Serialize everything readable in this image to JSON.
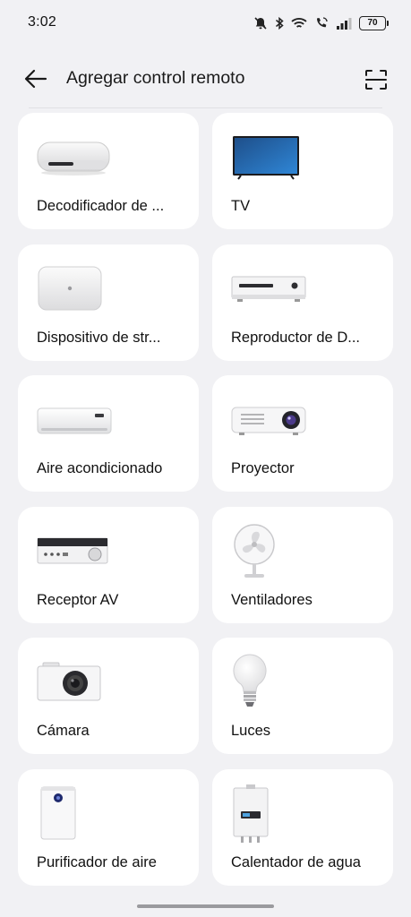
{
  "status_bar": {
    "time": "3:02",
    "battery": "70",
    "icons": [
      "mute-bell-icon",
      "bluetooth-icon",
      "wifi-icon",
      "wifi-calling-icon",
      "signal-icon",
      "battery-icon"
    ]
  },
  "header": {
    "title": "Agregar control remoto",
    "back_icon": "arrow-left-icon",
    "scan_icon": "scan-frame-icon"
  },
  "devices": [
    {
      "label": "Decodificador de ...",
      "icon": "set-top-box-icon"
    },
    {
      "label": "TV",
      "icon": "tv-icon"
    },
    {
      "label": "Dispositivo de str...",
      "icon": "streaming-device-icon"
    },
    {
      "label": "Reproductor de D...",
      "icon": "dvd-player-icon"
    },
    {
      "label": "Aire acondicionado",
      "icon": "air-conditioner-icon"
    },
    {
      "label": "Proyector",
      "icon": "projector-icon"
    },
    {
      "label": "Receptor AV",
      "icon": "av-receiver-icon"
    },
    {
      "label": "Ventiladores",
      "icon": "fan-icon"
    },
    {
      "label": "Cámara",
      "icon": "camera-icon"
    },
    {
      "label": "Luces",
      "icon": "light-bulb-icon"
    },
    {
      "label": "Purificador de aire",
      "icon": "air-purifier-icon"
    },
    {
      "label": "Calentador de agua",
      "icon": "water-heater-icon"
    }
  ],
  "colors": {
    "background": "#f1f1f4",
    "card": "#ffffff",
    "text": "#111111"
  }
}
